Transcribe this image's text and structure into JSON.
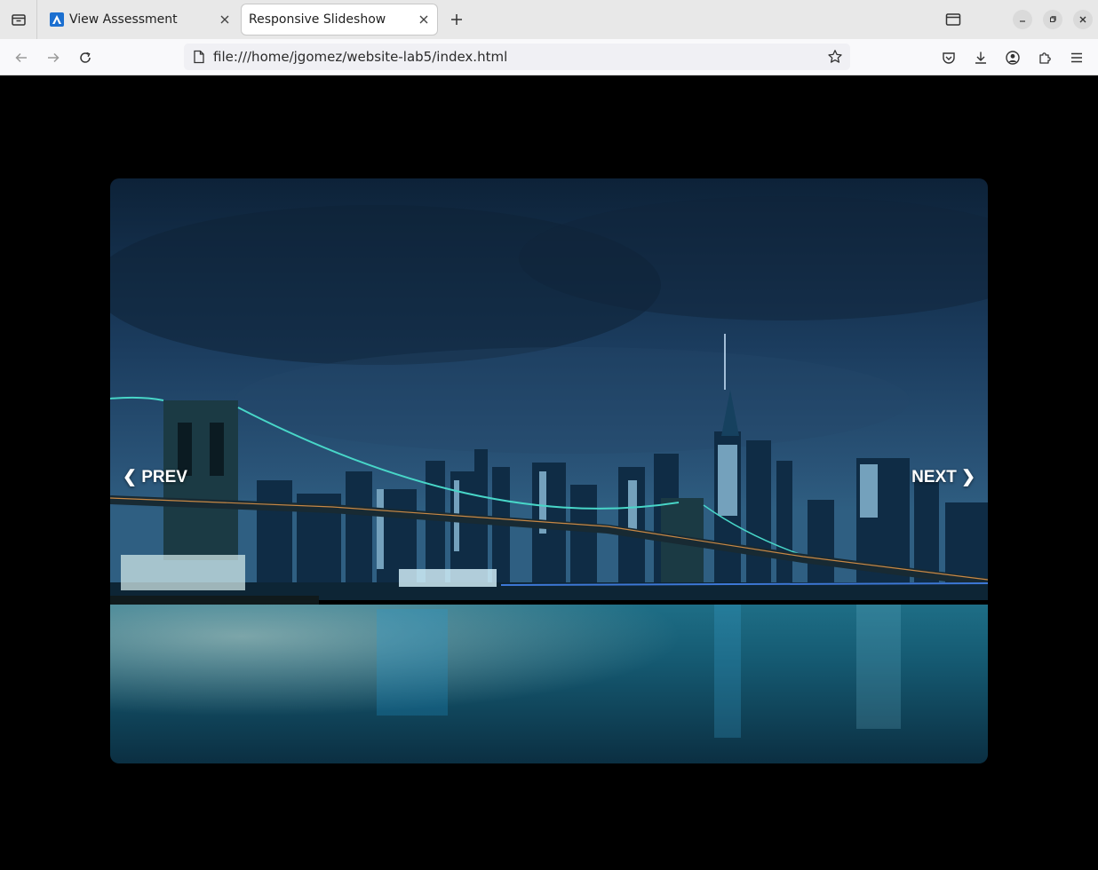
{
  "browser": {
    "tabs": [
      {
        "title": "View Assessment",
        "favicon": "canvas-logo-icon",
        "active": false
      },
      {
        "title": "Responsive Slideshow",
        "favicon": "none",
        "active": true
      }
    ],
    "url": "file:///home/jgomez/website-lab5/index.html",
    "accent_color": "#1b6fd0"
  },
  "slideshow": {
    "image_subject": "night-city-skyline-bridge",
    "prev_label": "❮ PREV",
    "next_label": "NEXT ❯"
  }
}
